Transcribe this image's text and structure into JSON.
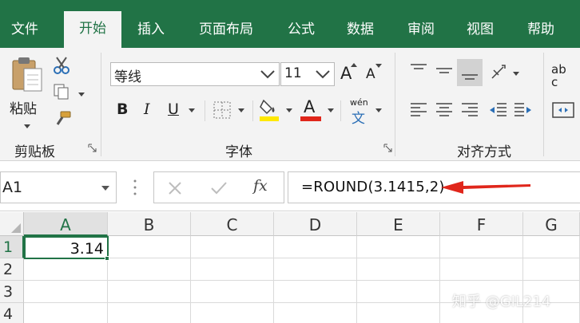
{
  "tabs": [
    {
      "label": "文件",
      "active": false
    },
    {
      "label": "开始",
      "active": true
    },
    {
      "label": "插入",
      "active": false
    },
    {
      "label": "页面布局",
      "active": false
    },
    {
      "label": "公式",
      "active": false
    },
    {
      "label": "数据",
      "active": false
    },
    {
      "label": "审阅",
      "active": false
    },
    {
      "label": "视图",
      "active": false
    },
    {
      "label": "帮助",
      "active": false
    }
  ],
  "ribbon": {
    "clipboard": {
      "paste_label": "粘贴",
      "group_label": "剪贴板"
    },
    "font": {
      "font_name": "等线",
      "font_size": "11",
      "group_label": "字体",
      "bold": "B",
      "italic": "I",
      "underline": "U",
      "font_color_letter": "A",
      "phonetic_top": "wén",
      "phonetic_bottom": "文",
      "grow_letter": "A",
      "shrink_letter": "A"
    },
    "alignment": {
      "group_label": "对齐方式",
      "wrap_top": "ab",
      "wrap_bottom": "c"
    }
  },
  "formula_bar": {
    "name_box": "A1",
    "fx_label": "fx",
    "formula": "=ROUND(3.1415,2)"
  },
  "sheet": {
    "columns": [
      "A",
      "B",
      "C",
      "D",
      "E",
      "F",
      "G"
    ],
    "rows": [
      "1",
      "2",
      "3",
      "4"
    ],
    "cells": {
      "A1": "3.14"
    }
  },
  "watermark": "知乎 @GIL214",
  "colors": {
    "accent": "#217346",
    "arrow": "#e0261b",
    "fill_yellow": "#ffe800",
    "font_red": "#e0261b"
  }
}
